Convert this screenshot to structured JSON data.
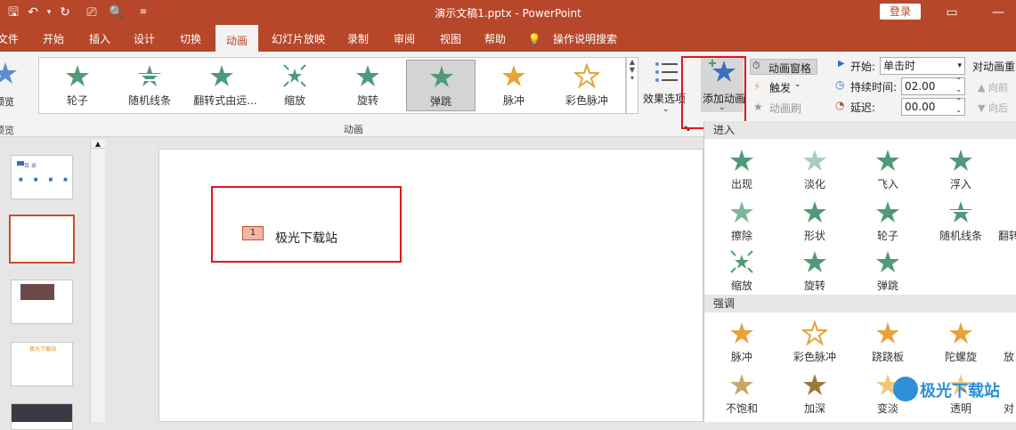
{
  "titlebar": {
    "doc_title": "演示文稿1.pptx - PowerPoint",
    "login": "登录"
  },
  "menu": [
    "文件",
    "开始",
    "插入",
    "设计",
    "切换",
    "动画",
    "幻灯片放映",
    "录制",
    "审阅",
    "视图",
    "帮助",
    "操作说明搜索"
  ],
  "ribbon": {
    "preview": "预览",
    "gallery": [
      "轮子",
      "随机线条",
      "翻转式由远...",
      "缩放",
      "旋转",
      "弹跳",
      "脉冲",
      "彩色脉冲"
    ],
    "effect_options": "效果选项",
    "group_animation": "动画",
    "add_animation": "添加动画",
    "animation_pane": "动画窗格",
    "trigger": "触发",
    "animation_painter": "动画刷",
    "start_label": "开始:",
    "start_value": "单击时",
    "duration_label": "持续时间:",
    "duration_value": "02.00",
    "delay_label": "延迟:",
    "delay_value": "00.00",
    "reorder": "对动画重",
    "move_earlier": "向前",
    "move_later": "向后"
  },
  "slide": {
    "tag_number": "1",
    "text": "极光下载站"
  },
  "thumbs": {
    "s1_title": "目 录",
    "s4_title": "极光下载站"
  },
  "dropdown": {
    "enter_title": "进入",
    "enter": [
      "出现",
      "淡化",
      "飞入",
      "浮入",
      "擦除",
      "形状",
      "轮子",
      "随机线条",
      "翻转",
      "缩放",
      "旋转",
      "弹跳"
    ],
    "emphasis_title": "强调",
    "emphasis": [
      "脉冲",
      "彩色脉冲",
      "跷跷板",
      "陀螺旋",
      "放",
      "不饱和",
      "加深",
      "变淡",
      "透明",
      "对"
    ]
  },
  "watermark": "极光下载站",
  "colors": {
    "accent": "#b7472a",
    "enter_star": "#4f9a78",
    "emph_star": "#e8a23a",
    "highlight": "#e0161b"
  }
}
